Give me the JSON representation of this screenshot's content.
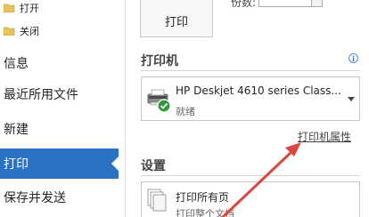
{
  "nav": {
    "open": "打开",
    "close": "关闭",
    "info": "信息",
    "recent": "最近所用文件",
    "new": "新建",
    "print": "打印",
    "save_send": "保存并发送"
  },
  "print_panel": {
    "print_button": "打印",
    "copies_label": "份数:"
  },
  "printer_section": {
    "title": "打印机",
    "printer_name": "HP Deskjet 4610 series Class...",
    "printer_status": "就绪",
    "properties_link": "打印机属性"
  },
  "settings_section": {
    "title": "设置",
    "setting_main": "打印所有页",
    "setting_sub": "打印整个文档"
  },
  "colors": {
    "accent": "#2a72c4",
    "annotation_arrow": "#d9473f",
    "ready_check": "#2f9a3a"
  }
}
